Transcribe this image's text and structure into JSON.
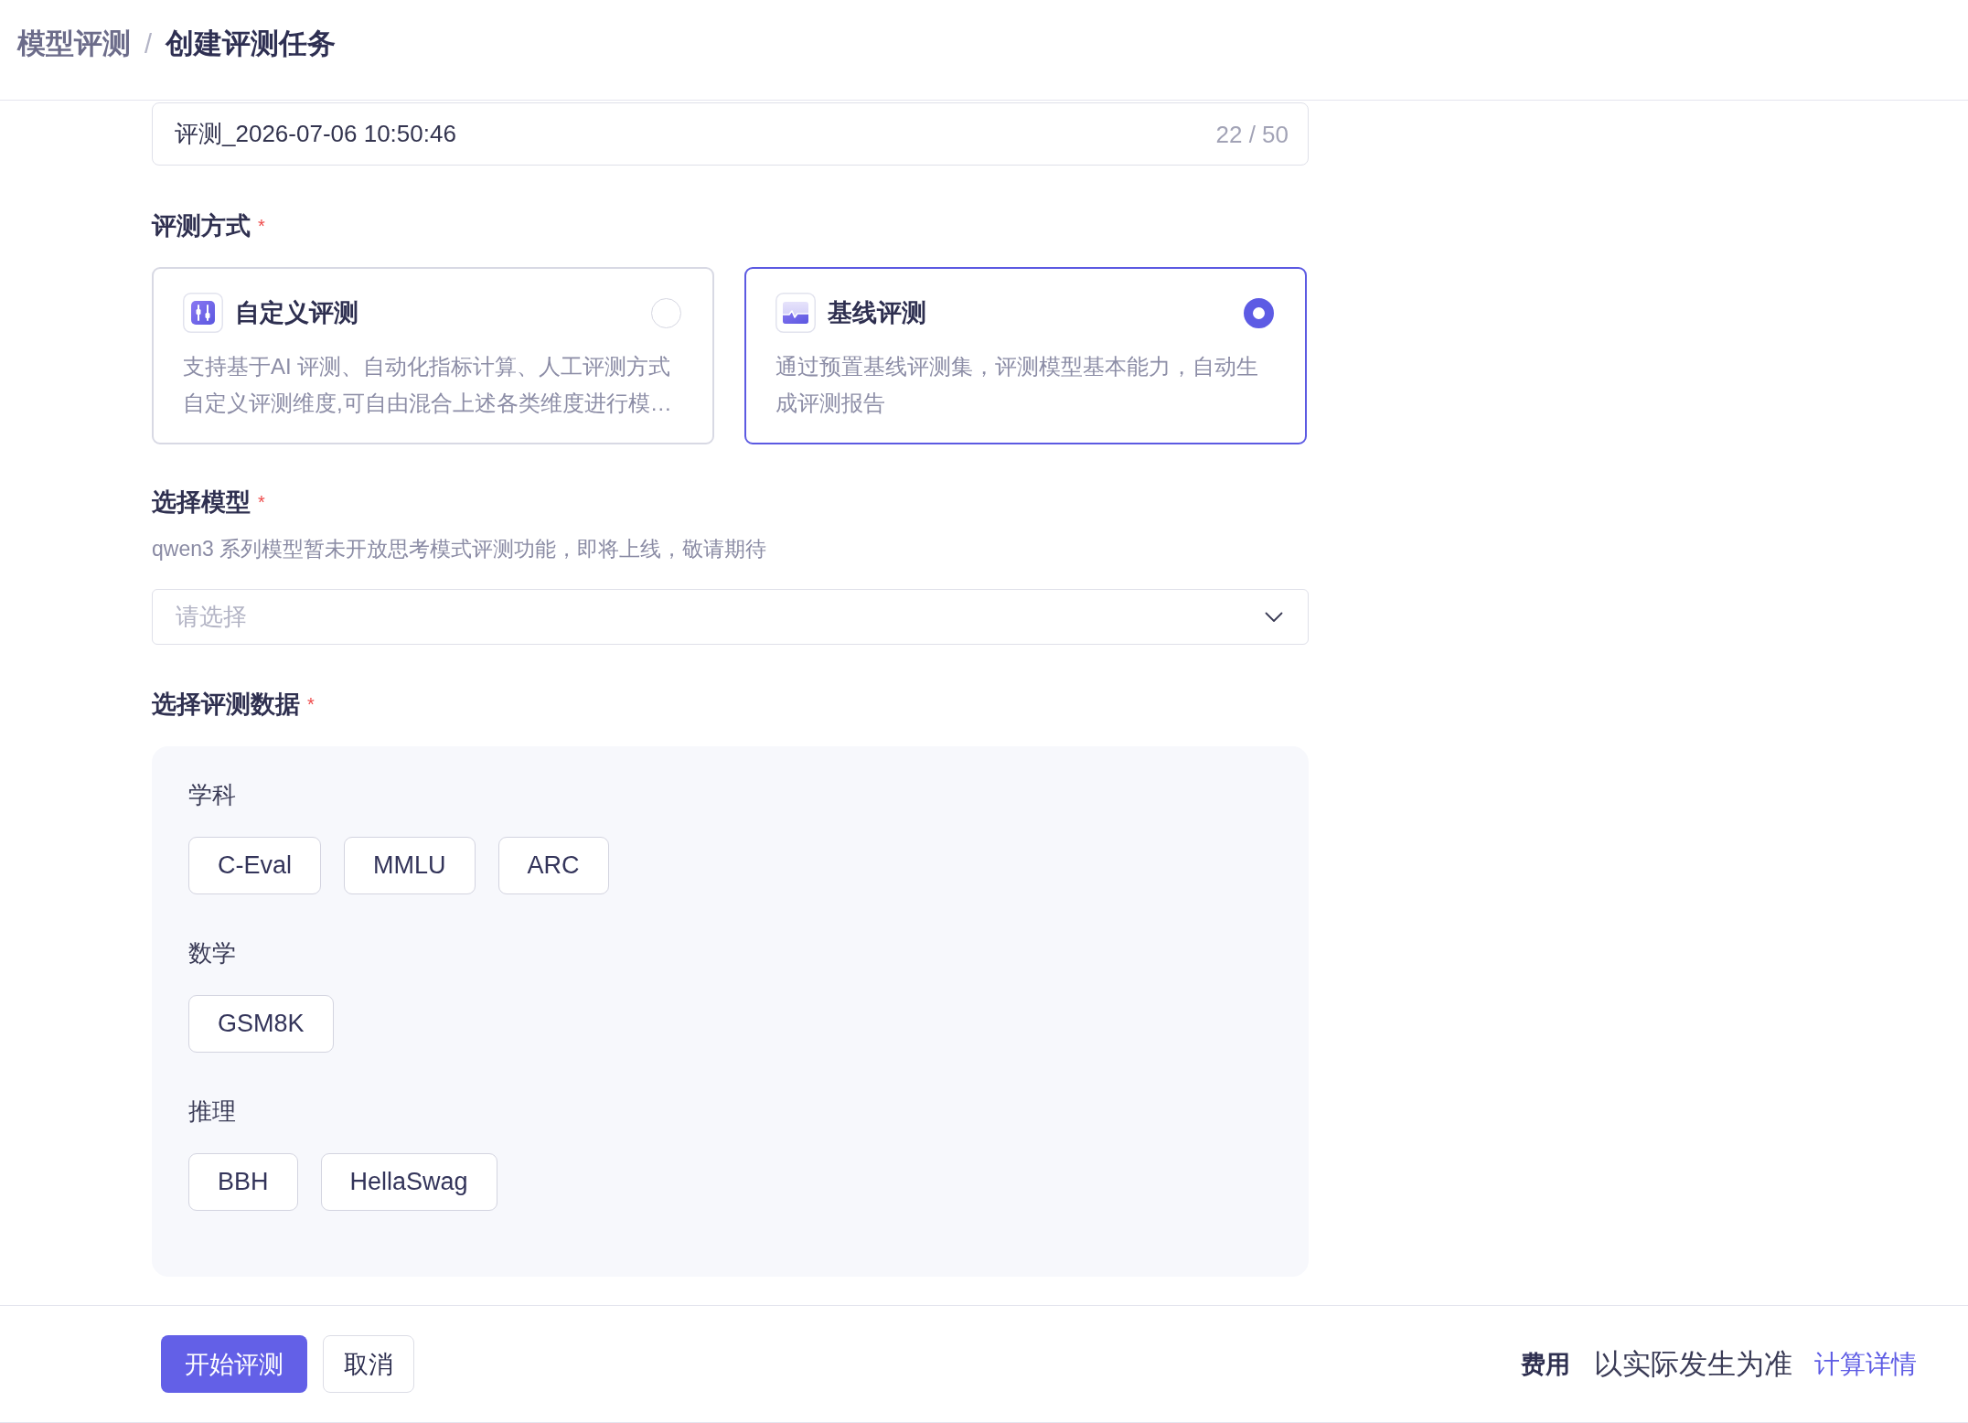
{
  "breadcrumb": {
    "items": [
      {
        "label": "模型评测",
        "current": false
      },
      {
        "label": "创建评测任务",
        "current": true
      }
    ],
    "separator": "/"
  },
  "task_name": {
    "value": "评测_2026-07-06 10:50:46",
    "counter": "22 / 50"
  },
  "eval_method": {
    "label": "评测方式",
    "required_mark": "*",
    "options": [
      {
        "kind": "custom",
        "title": "自定义评测",
        "description": "支持基于AI 评测、自动化指标计算、人工评测方式自定义评测维度,可自由混合上述各类维度进行模…",
        "selected": false
      },
      {
        "kind": "baseline",
        "title": "基线评测",
        "description": "通过预置基线评测集，评测模型基本能力，自动生成评测报告",
        "selected": true
      }
    ]
  },
  "model": {
    "label": "选择模型",
    "required_mark": "*",
    "hint": "qwen3 系列模型暂未开放思考模式评测功能，即将上线，敬请期待",
    "select": {
      "placeholder": "请选择"
    }
  },
  "eval_data": {
    "label": "选择评测数据",
    "required_mark": "*",
    "groups": [
      {
        "title": "学科",
        "datasets": [
          {
            "label": "C-Eval",
            "selected": false
          },
          {
            "label": "MMLU",
            "selected": false
          },
          {
            "label": "ARC",
            "selected": false
          }
        ]
      },
      {
        "title": "数学",
        "datasets": [
          {
            "label": "GSM8K",
            "selected": false
          }
        ]
      },
      {
        "title": "推理",
        "datasets": [
          {
            "label": "BBH",
            "selected": false
          },
          {
            "label": "HellaSwag",
            "selected": false
          }
        ]
      }
    ]
  },
  "footer": {
    "buttons": [
      {
        "kind": "primary",
        "label": "开始评测"
      },
      {
        "kind": "default",
        "label": "取消"
      }
    ],
    "cost_label": "费用",
    "cost_note": "以实际发生为准",
    "cost_link": "计算详情"
  }
}
